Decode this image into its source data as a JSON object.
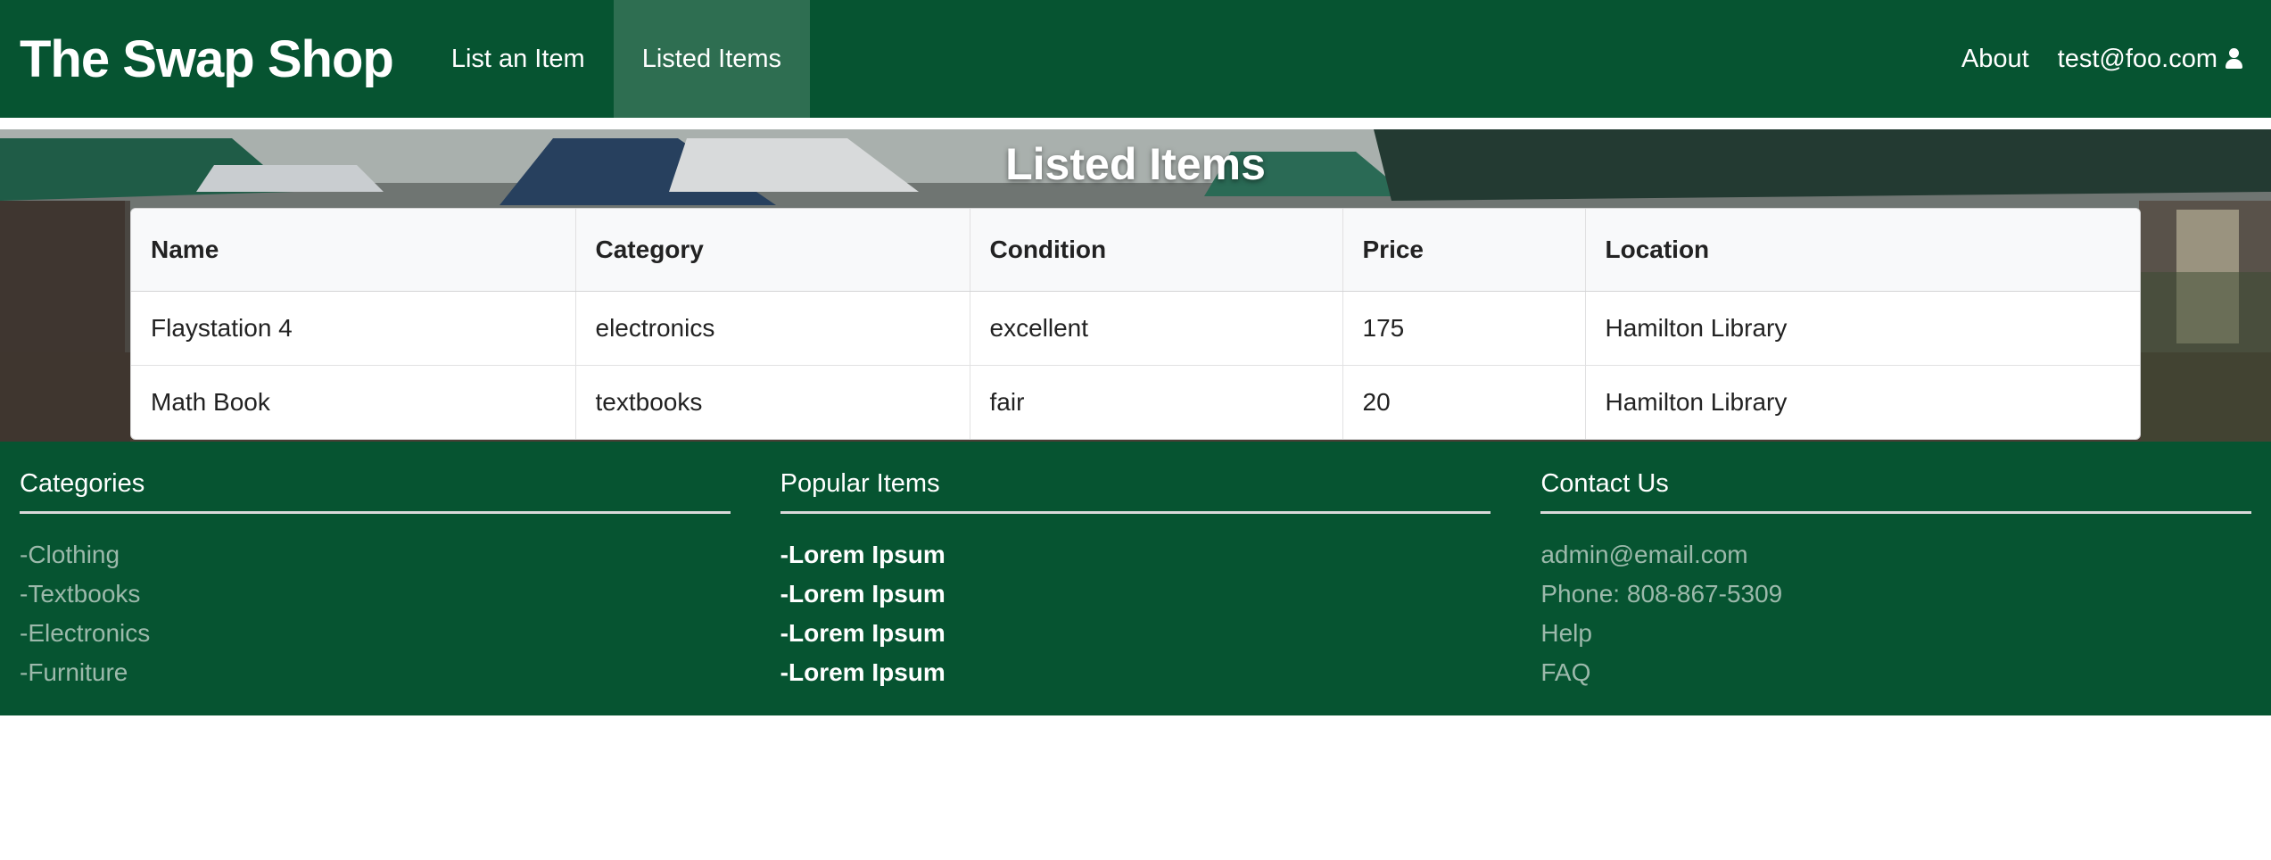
{
  "navbar": {
    "brand": "The Swap Shop",
    "items": [
      {
        "label": "List an Item"
      },
      {
        "label": "Listed Items"
      }
    ],
    "about": "About",
    "user_email": "test@foo.com"
  },
  "hero": {
    "title": "Listed Items"
  },
  "table": {
    "columns": [
      "Name",
      "Category",
      "Condition",
      "Price",
      "Location"
    ],
    "rows": [
      [
        "Flaystation 4",
        "electronics",
        "excellent",
        "175",
        "Hamilton Library"
      ],
      [
        "Math Book",
        "textbooks",
        "fair",
        "20",
        "Hamilton Library"
      ]
    ]
  },
  "footer": {
    "categories": {
      "heading": "Categories",
      "links": [
        "-Clothing",
        "-Textbooks",
        "-Electronics",
        "-Furniture"
      ]
    },
    "popular": {
      "heading": "Popular Items",
      "links": [
        "-Lorem Ipsum",
        "-Lorem Ipsum",
        "-Lorem Ipsum",
        "-Lorem Ipsum"
      ]
    },
    "contact": {
      "heading": "Contact Us",
      "links": [
        "admin@email.com",
        "Phone: 808-867-5309",
        "Help",
        "FAQ"
      ]
    }
  },
  "colors": {
    "primary_green": "#065431",
    "active_nav": "#2e6e51",
    "footer_link": "#9cb9ab"
  },
  "icons": {
    "user": "user-icon"
  }
}
